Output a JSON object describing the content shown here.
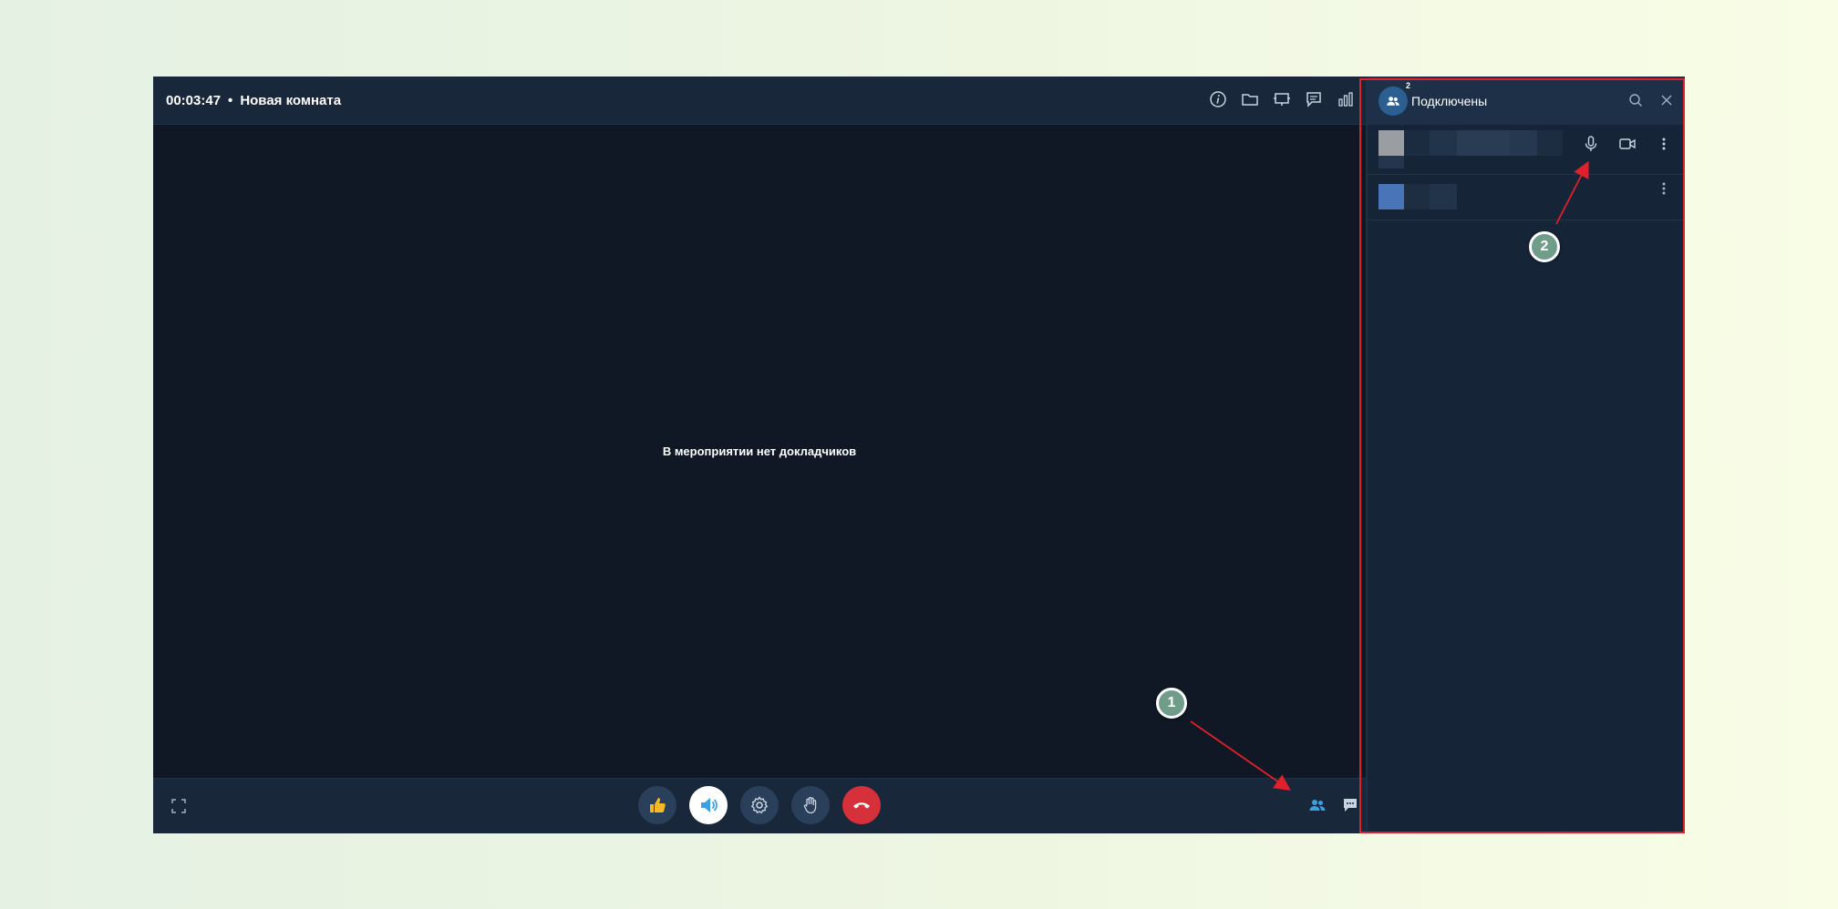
{
  "topbar": {
    "timer": "00:03:47",
    "separator": "•",
    "room_name": "Новая комната",
    "icons": [
      "info-icon",
      "folder-icon",
      "screen-share-icon",
      "chat-icon",
      "stats-icon"
    ]
  },
  "stage": {
    "message": "В мероприятии нет докладчиков"
  },
  "controls": {
    "center": [
      "like-icon",
      "sound-icon",
      "settings-icon",
      "raise-hand-icon",
      "hangup-icon"
    ],
    "right": [
      "participants-icon",
      "chat-icon"
    ]
  },
  "panel": {
    "count": "2",
    "title": "Подключены",
    "participants": [
      {
        "icons": [
          "microphone-icon",
          "camera-icon",
          "more-icon"
        ]
      },
      {
        "icons": [
          "more-icon"
        ]
      }
    ]
  },
  "annotations": {
    "marker_1": "1",
    "marker_2": "2"
  },
  "colors": {
    "accent": "#3aa0e6",
    "hangup": "#d6303a",
    "highlight": "#e0202a",
    "marker": "#6f9d8a"
  }
}
